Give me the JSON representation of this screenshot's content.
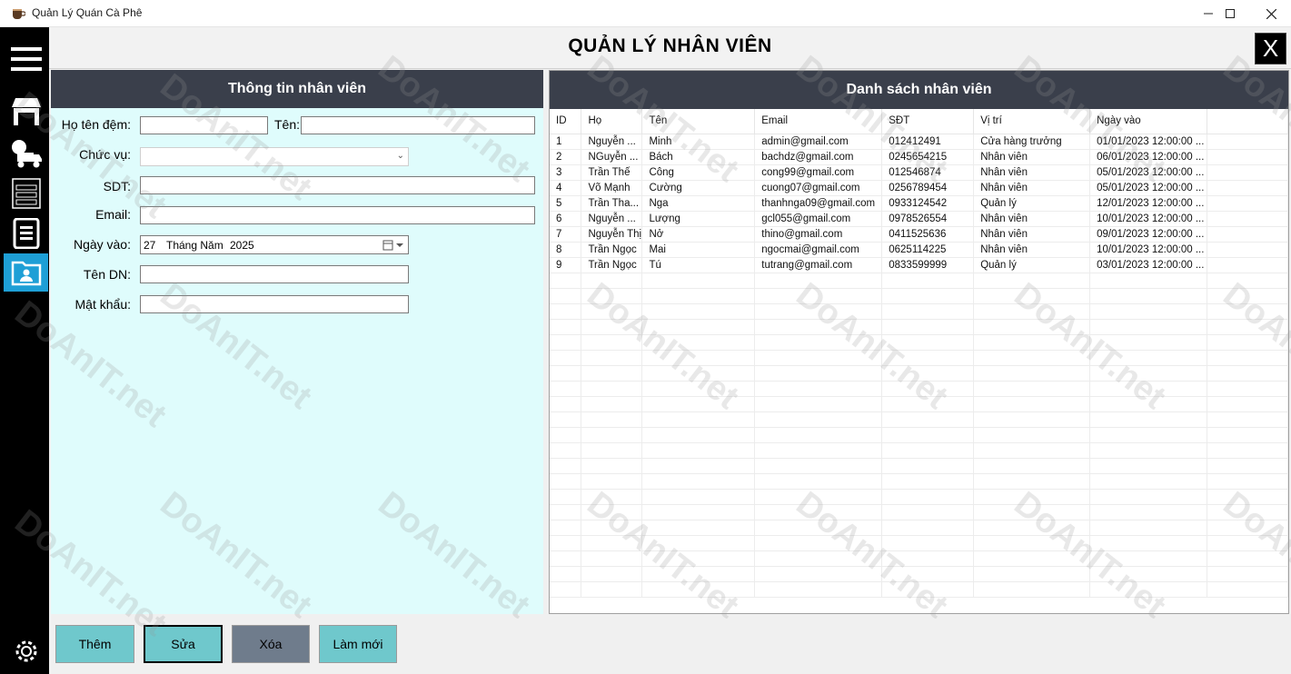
{
  "window": {
    "title": "Quản Lý Quán Cà Phê",
    "minimize": "—",
    "maximize": "☐",
    "close": "✕"
  },
  "header": {
    "title": "QUẢN LÝ NHÂN VIÊN",
    "close_label": "X"
  },
  "sidebar": {
    "items": [
      {
        "name": "menu-icon"
      },
      {
        "name": "store-icon"
      },
      {
        "name": "delivery-icon"
      },
      {
        "name": "table-icon"
      },
      {
        "name": "invoice-icon"
      },
      {
        "name": "employee-folder-icon"
      },
      {
        "name": "settings-gear-icon"
      }
    ]
  },
  "form": {
    "panel_title": "Thông tin nhân viên",
    "ho_ten_dem_label": "Họ tên đệm:",
    "ten_label": "Tên:",
    "chuc_vu_label": "Chức vụ:",
    "sdt_label": "SDT:",
    "email_label": "Email:",
    "ngay_vao_label": "Ngày vào:",
    "ten_dn_label": "Tên DN:",
    "mat_khau_label": "Mật khẩu:",
    "ho_ten_dem_value": "",
    "ten_value": "",
    "chuc_vu_value": "",
    "sdt_value": "",
    "email_value": "",
    "ngay_vao": {
      "day": "27",
      "month": "Tháng Năm",
      "year": "2025"
    },
    "ten_dn_value": "",
    "mat_khau_value": ""
  },
  "list": {
    "panel_title": "Danh sách nhân viên",
    "columns": [
      "ID",
      "Họ",
      "Tên",
      "Email",
      "SĐT",
      "Vị trí",
      "Ngày vào"
    ],
    "rows": [
      [
        "1",
        "Nguyễn ...",
        "Minh",
        "admin@gmail.com",
        "012412491",
        "Cửa hàng trưởng",
        "01/01/2023 12:00:00 ..."
      ],
      [
        "2",
        "NGuyễn ...",
        "Bách",
        "bachdz@gmail.com",
        "0245654215",
        "Nhân viên",
        "06/01/2023 12:00:00 ..."
      ],
      [
        "3",
        "Trần Thế",
        "Công",
        "cong99@gmail.com",
        "012546874",
        "Nhân viên",
        "05/01/2023 12:00:00 ..."
      ],
      [
        "4",
        "Võ Mạnh",
        "Cường",
        "cuong07@gmail.com",
        "0256789454",
        "Nhân viên",
        "05/01/2023 12:00:00 ..."
      ],
      [
        "5",
        "Trần Tha...",
        "Nga",
        "thanhnga09@gmail.com",
        "0933124542",
        "Quản lý",
        "12/01/2023 12:00:00 ..."
      ],
      [
        "6",
        "Nguyễn ...",
        "Lượng",
        "gcl055@gmail.com",
        "0978526554",
        "Nhân viên",
        "10/01/2023 12:00:00 ..."
      ],
      [
        "7",
        "Nguyễn Thị",
        "Nở",
        "thino@gmail.com",
        "0411525636",
        "Nhân viên",
        "09/01/2023 12:00:00 ..."
      ],
      [
        "8",
        "Trần Ngọc",
        "Mai",
        "ngocmai@gmail.com",
        "0625114225",
        "Nhân viên",
        "10/01/2023 12:00:00 ..."
      ],
      [
        "9",
        "Trần Ngọc",
        "Tú",
        "tutrang@gmail.com",
        "0833599999",
        "Quản lý",
        "03/01/2023 12:00:00 ..."
      ]
    ]
  },
  "buttons": {
    "them": "Thêm",
    "sua": "Sửa",
    "xoa": "Xóa",
    "lam_moi": "Làm mới"
  },
  "colors": {
    "sidebar": "#000000",
    "active": "#1e9fd6",
    "panel_head": "#3a3f4b",
    "form_bg": "#dffcfc",
    "btn_teal": "#6fc8cc",
    "btn_gray": "#6f7c8c"
  },
  "watermark": "DoAnIT.net"
}
